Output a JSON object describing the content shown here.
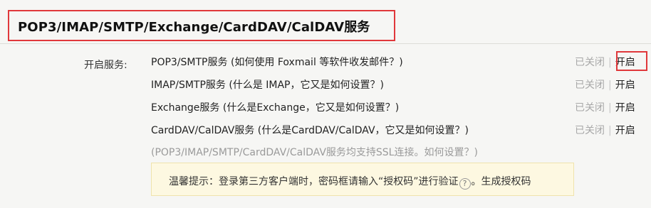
{
  "section": {
    "title": "POP3/IMAP/SMTP/Exchange/CardDAV/CalDAV服务"
  },
  "services_label": "开启服务:",
  "services": [
    {
      "name": "POP3/SMTP服务",
      "help": "(如何使用 Foxmail 等软件收发邮件？)",
      "status": "已关闭",
      "separator": "|",
      "action": "开启"
    },
    {
      "name": "IMAP/SMTP服务",
      "help": "(什么是 IMAP，它又是如何设置？)",
      "status": "已关闭",
      "separator": "|",
      "action": "开启"
    },
    {
      "name": "Exchange服务",
      "help": "(什么是Exchange，它又是如何设置？)",
      "status": "已关闭",
      "separator": "|",
      "action": "开启"
    },
    {
      "name": "CardDAV/CalDAV服务",
      "help": "(什么是CardDAV/CalDAV，它又是如何设置？)",
      "status": "已关闭",
      "separator": "|",
      "action": "开启"
    }
  ],
  "ssl_note": {
    "text": "(POP3/IMAP/SMTP/CardDAV/CalDAV服务均支持SSL连接。",
    "link": "如何设置？)"
  },
  "tip": {
    "text": "温馨提示：登录第三方客户端时，密码框请输入“授权码”进行验证",
    "help_icon_glyph": "?",
    "after_icon": "。",
    "link": "生成授权码"
  },
  "colors": {
    "highlight_border": "#e0383b",
    "tip_background": "#fdf8e1",
    "status_off": "#a8a8a8"
  },
  "icons": {
    "help": "question-circle-icon"
  }
}
